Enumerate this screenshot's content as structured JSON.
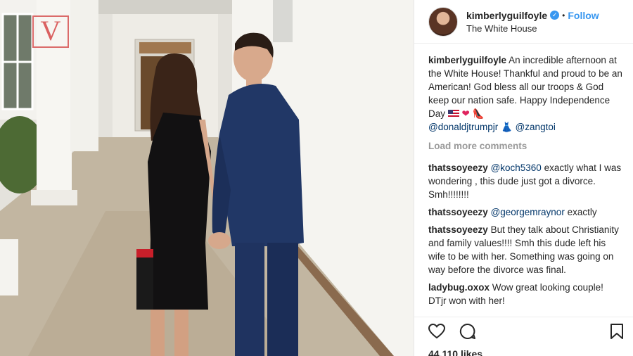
{
  "watermark": "V",
  "post": {
    "username": "kimberlyguilfoyle",
    "separator": "•",
    "follow_label": "Follow",
    "location": "The White House",
    "likes": "44,110 likes"
  },
  "caption": {
    "user": "kimberlyguilfoyle",
    "text": "An incredible afternoon at the White House! Thankful and proud to be an American! God bless all our troops & God keep our nation safe. Happy Independence Day",
    "mention_1": "@donaldjtrumpjr",
    "mention_2": "@zangtoi"
  },
  "load_more_label": "Load more comments",
  "comments": [
    {
      "user": "thatssoyeezy",
      "mention": "@koch5360",
      "text": "exactly what I was wondering , this dude just got a divorce. Smh!!!!!!!!"
    },
    {
      "user": "thatssoyeezy",
      "mention": "@georgemraynor",
      "text": "exactly"
    },
    {
      "user": "thatssoyeezy",
      "mention": "",
      "text": "But they talk about Christianity and family values!!!! Smh this dude left his wife to be with her. Something was going on way before the divorce was final."
    },
    {
      "user": "ladybug.oxox",
      "mention": "",
      "text": "Wow great looking couple! DTjr won with her!"
    }
  ],
  "icons": {
    "verified": "verified-badge",
    "like": "heart-icon",
    "comment": "comment-icon",
    "save": "bookmark-icon"
  },
  "colors": {
    "link": "#3897f0",
    "mention": "#003569",
    "muted": "#999999"
  }
}
